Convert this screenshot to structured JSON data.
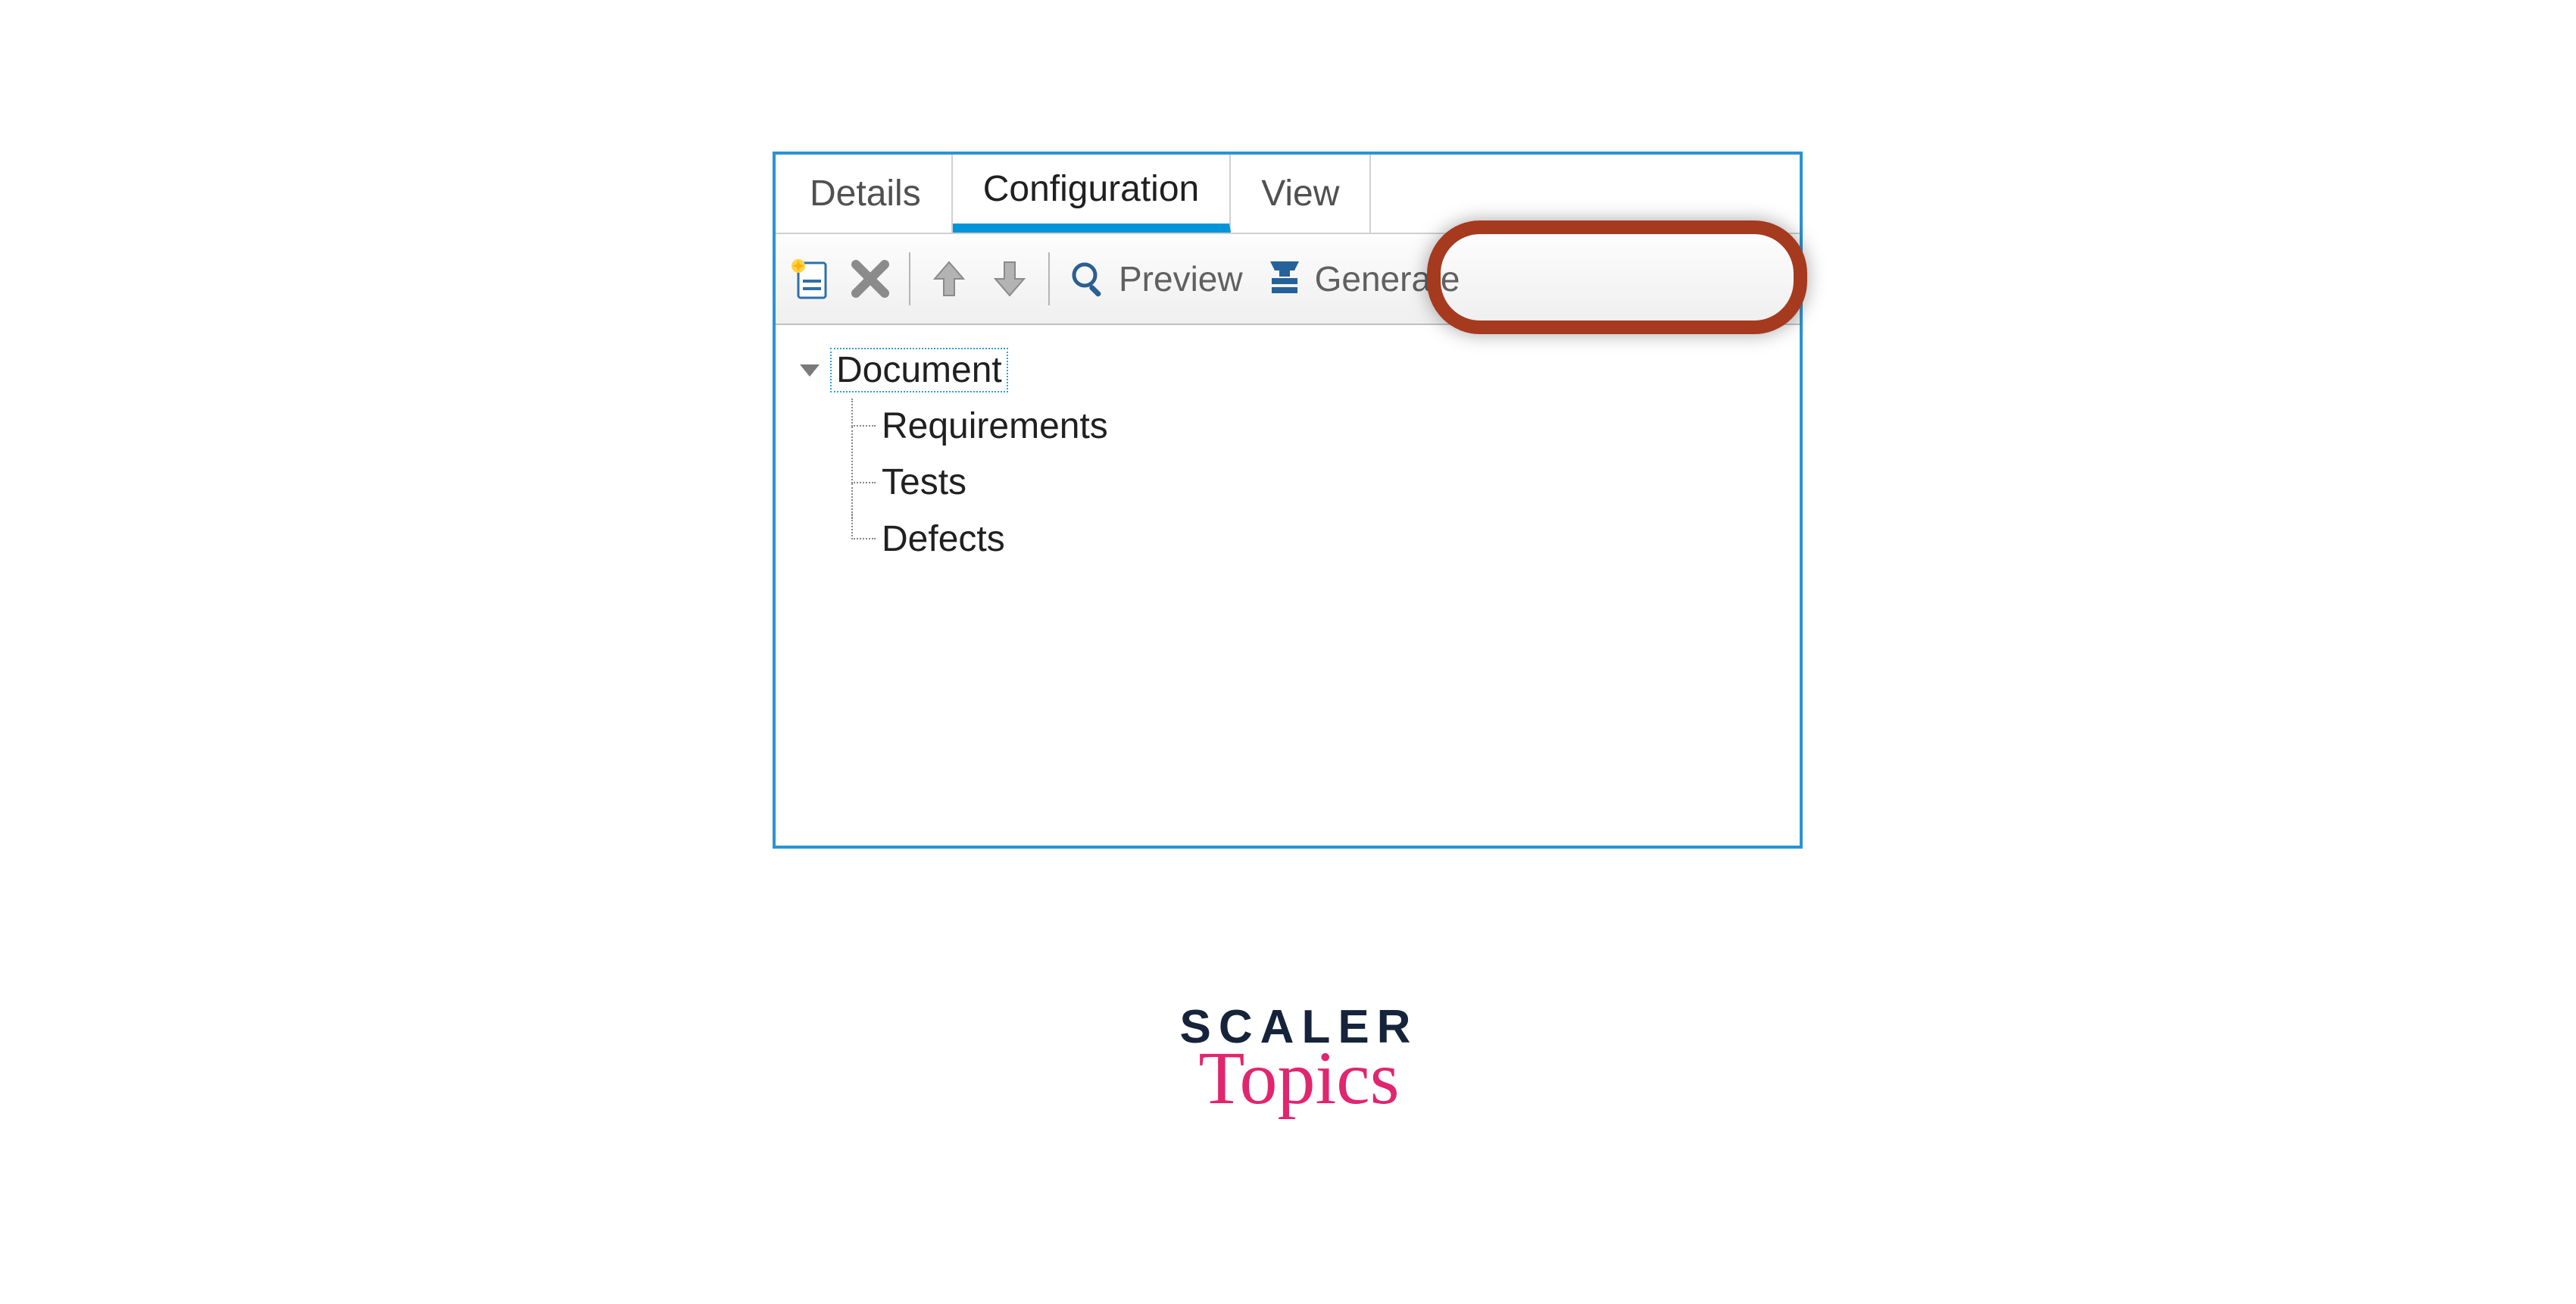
{
  "tabs": {
    "details": "Details",
    "configuration": "Configuration",
    "view": "View"
  },
  "toolbar": {
    "preview": "Preview",
    "generate": "Generate"
  },
  "tree": {
    "root": "Document",
    "children": [
      "Requirements",
      "Tests",
      "Defects"
    ]
  },
  "logo": {
    "line1": "SCALER",
    "line2": "Topics"
  }
}
